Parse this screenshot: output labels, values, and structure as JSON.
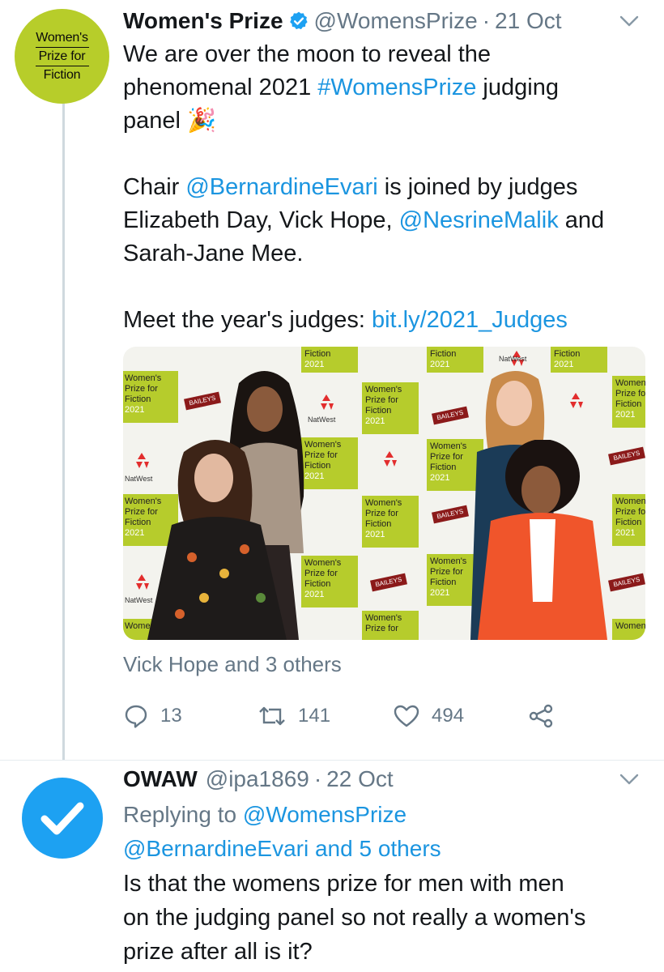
{
  "tweet": {
    "avatar": {
      "lines": [
        "Women's",
        "Prize for",
        "Fiction"
      ],
      "bg_color": "#b7cd2a"
    },
    "author_name": "Women's Prize",
    "handle": "@WomensPrize",
    "separator": "·",
    "date": "21 Oct",
    "text": {
      "line1": "We are over the moon to reveal the",
      "line2_a": "phenomenal 2021 ",
      "line2_hashtag": "#WomensPrize",
      "line2_b": " judging",
      "line3": "panel 🎉",
      "line4_a": "Chair ",
      "line4_mention": "@BernardineEvari",
      "line4_b": " is joined by judges",
      "line5_a": "Elizabeth Day, Vick Hope, ",
      "line5_mention": "@NesrineMalik",
      "line5_b": " and",
      "line6": "Sarah-Jane Mee.",
      "line7_a": "Meet the year's judges: ",
      "line7_link": "bit.ly/2021_Judges"
    },
    "media": {
      "wall_text": {
        "womens": "Women's",
        "prize_for": "Prize for",
        "fiction": "Fiction",
        "year": "2021",
        "natwest": "NatWest",
        "baileys": "BAILEYS"
      }
    },
    "tagged": "Vick Hope and 3 others",
    "actions": {
      "replies": "13",
      "retweets": "141",
      "likes": "494"
    }
  },
  "reply": {
    "author_name": "OWAW",
    "handle": "@ipa1869",
    "separator": "·",
    "date": "22 Oct",
    "replying_prefix": "Replying to ",
    "replying_handle": "@WomensPrize",
    "replying_line2": "@BernardineEvari and 5 others",
    "text_line1": "Is that the womens prize for men with men",
    "text_line2": "on the judging panel so not really a women's",
    "text_line3": "prize after all is it?"
  },
  "colors": {
    "link": "#1b95e0",
    "muted": "#657786",
    "verified": "#1da1f2",
    "wall_green": "#b6cc2c"
  },
  "icons": [
    "verified-badge-icon",
    "chevron-down-icon",
    "reply-icon",
    "retweet-icon",
    "like-icon",
    "share-icon",
    "checkmark-icon"
  ]
}
